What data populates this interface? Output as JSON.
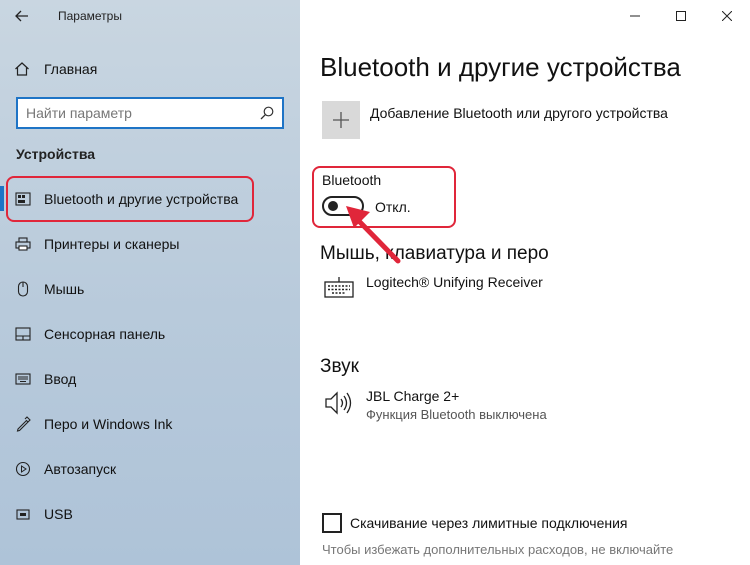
{
  "window": {
    "title": "Параметры"
  },
  "sidebar": {
    "home_label": "Главная",
    "search_placeholder": "Найти параметр",
    "section_title": "Устройства",
    "items": [
      {
        "label": "Bluetooth и другие устройства",
        "icon": "bluetooth-devices-icon"
      },
      {
        "label": "Принтеры и сканеры",
        "icon": "printer-icon"
      },
      {
        "label": "Мышь",
        "icon": "mouse-icon"
      },
      {
        "label": "Сенсорная панель",
        "icon": "touchpad-icon"
      },
      {
        "label": "Ввод",
        "icon": "keyboard-icon"
      },
      {
        "label": "Перо и Windows Ink",
        "icon": "pen-icon"
      },
      {
        "label": "Автозапуск",
        "icon": "autoplay-icon"
      },
      {
        "label": "USB",
        "icon": "usb-icon"
      }
    ]
  },
  "main": {
    "title": "Bluetooth и другие устройства",
    "add_label": "Добавление Bluetooth или другого устройства",
    "bluetooth_label": "Bluetooth",
    "bluetooth_state": "Откл.",
    "mouse_section": "Мышь, клавиатура и перо",
    "mouse_device": "Logitech® Unifying Receiver",
    "sound_section": "Звук",
    "sound_device": "JBL Charge 2+",
    "sound_device_status": "Функция Bluetooth выключена",
    "metered_label": "Скачивание через лимитные подключения",
    "metered_note": "Чтобы избежать дополнительных расходов, не включайте"
  },
  "colors": {
    "accent": "#1e74c6",
    "annotation": "#e0263a"
  }
}
